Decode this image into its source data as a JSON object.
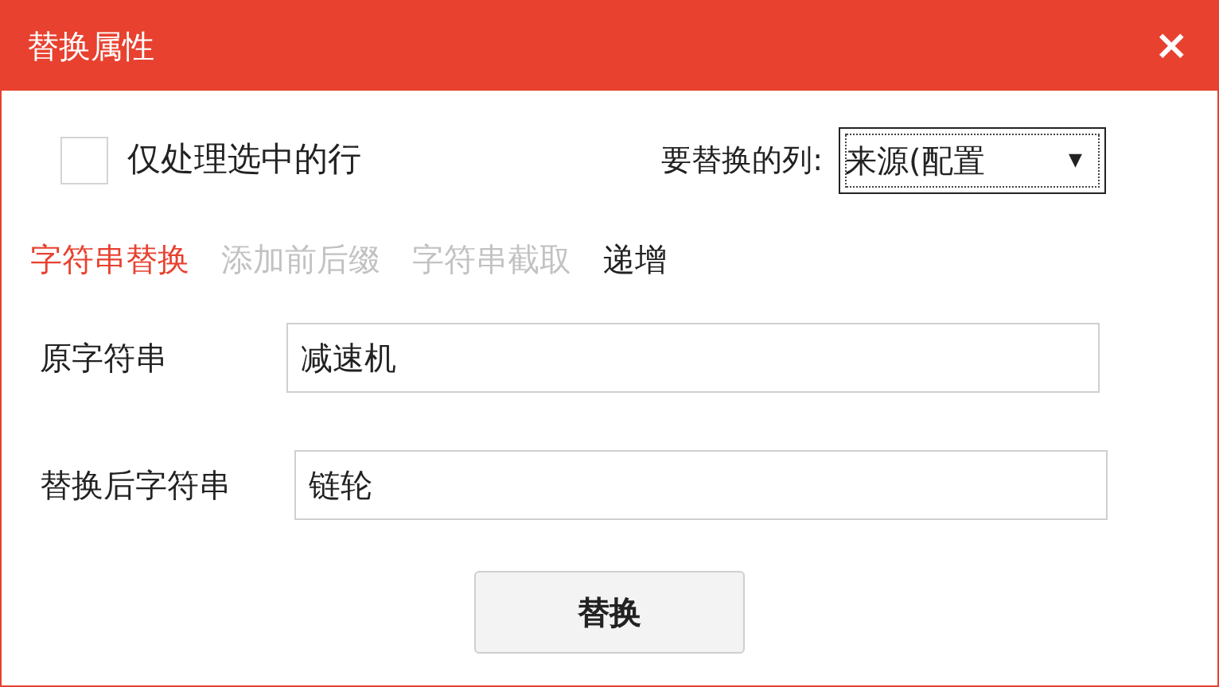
{
  "window": {
    "title": "替换属性",
    "close": "×"
  },
  "only_selected": {
    "label": "仅处理选中的行",
    "checked": false
  },
  "column": {
    "label": "要替换的列:",
    "value": "来源(配置",
    "caret": "▼"
  },
  "tabs": [
    {
      "label": "字符串替换",
      "selected": true,
      "disabled": false
    },
    {
      "label": "添加前后缀",
      "selected": false,
      "disabled": true
    },
    {
      "label": "字符串截取",
      "selected": false,
      "disabled": true
    },
    {
      "label": "递增",
      "selected": false,
      "disabled": false
    }
  ],
  "fields": [
    {
      "label": "原字符串",
      "value": "减速机"
    },
    {
      "label": "替换后字符串",
      "value": "链轮"
    }
  ],
  "button": "替换"
}
